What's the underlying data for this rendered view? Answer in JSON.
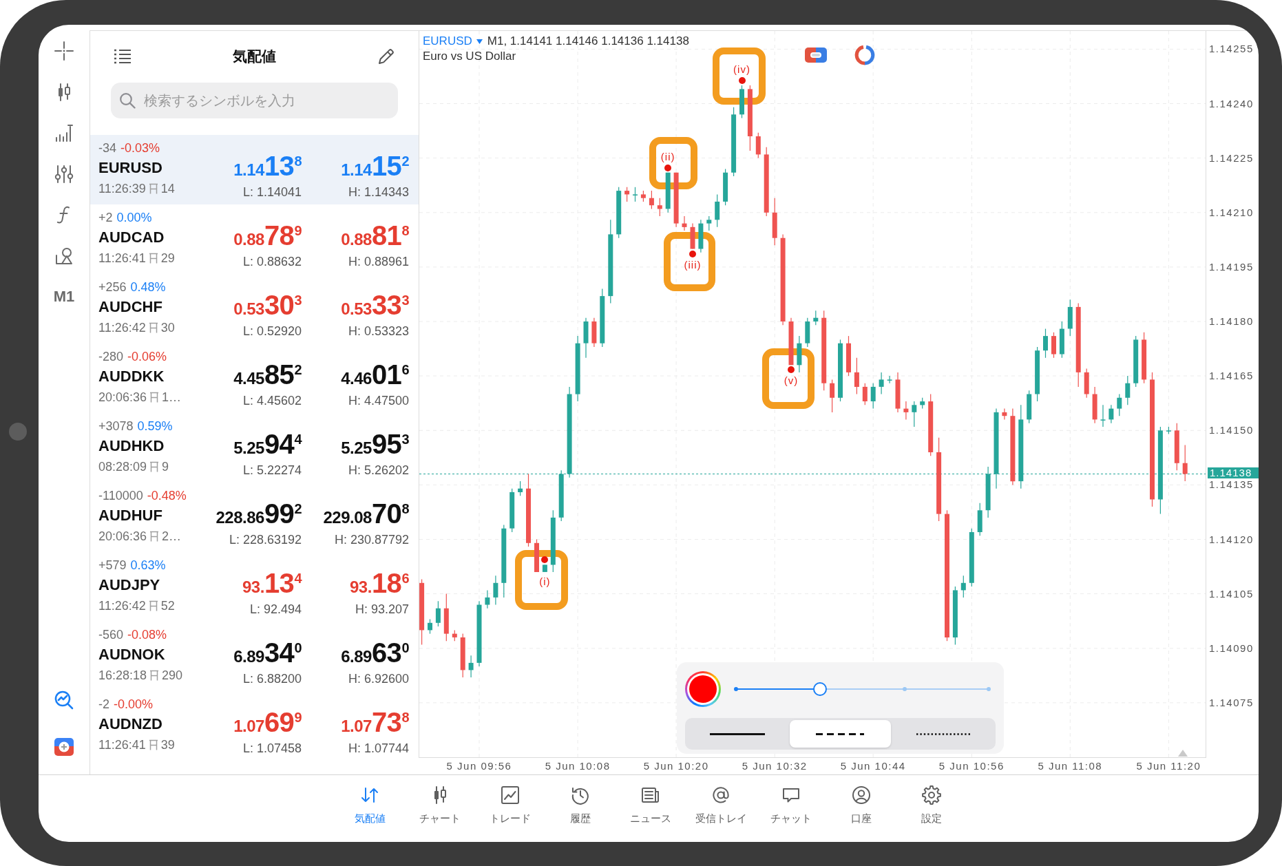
{
  "left_toolbar": {
    "timeframe": "M1"
  },
  "quotes": {
    "title": "気配値",
    "search": {
      "placeholder": "検索するシンボルを入力"
    },
    "rows": [
      {
        "change": "-34",
        "change_pct": {
          "text": "-0.03%",
          "color": "#e53d30"
        },
        "symbol": "EURUSD",
        "time": "11:26:39",
        "spread": "14",
        "bid": {
          "head": "1.14",
          "pips": "13",
          "point": "8",
          "color": "#1a7ff5"
        },
        "ask": {
          "head": "1.14",
          "pips": "15",
          "point": "2",
          "color": "#1a7ff5"
        },
        "low": "L: 1.14041",
        "high": "H: 1.14343",
        "selected": true
      },
      {
        "change": "+2",
        "change_pct": {
          "text": "0.00%",
          "color": "#1a7ff5"
        },
        "symbol": "AUDCAD",
        "time": "11:26:41",
        "spread": "29",
        "bid": {
          "head": "0.88",
          "pips": "78",
          "point": "9",
          "color": "#e53d30"
        },
        "ask": {
          "head": "0.88",
          "pips": "81",
          "point": "8",
          "color": "#e53d30"
        },
        "low": "L: 0.88632",
        "high": "H: 0.88961",
        "selected": false
      },
      {
        "change": "+256",
        "change_pct": {
          "text": "0.48%",
          "color": "#1a7ff5"
        },
        "symbol": "AUDCHF",
        "time": "11:26:42",
        "spread": "30",
        "bid": {
          "head": "0.53",
          "pips": "30",
          "point": "3",
          "color": "#e53d30"
        },
        "ask": {
          "head": "0.53",
          "pips": "33",
          "point": "3",
          "color": "#e53d30"
        },
        "low": "L: 0.52920",
        "high": "H: 0.53323",
        "selected": false
      },
      {
        "change": "-280",
        "change_pct": {
          "text": "-0.06%",
          "color": "#e53d30"
        },
        "symbol": "AUDDKK",
        "time": "20:06:36",
        "spread": "1…",
        "bid": {
          "head": "4.45",
          "pips": "85",
          "point": "2",
          "color": "#111111"
        },
        "ask": {
          "head": "4.46",
          "pips": "01",
          "point": "6",
          "color": "#111111"
        },
        "low": "L: 4.45602",
        "high": "H: 4.47500",
        "selected": false
      },
      {
        "change": "+3078",
        "change_pct": {
          "text": "0.59%",
          "color": "#1a7ff5"
        },
        "symbol": "AUDHKD",
        "time": "08:28:09",
        "spread": "9",
        "bid": {
          "head": "5.25",
          "pips": "94",
          "point": "4",
          "color": "#111111"
        },
        "ask": {
          "head": "5.25",
          "pips": "95",
          "point": "3",
          "color": "#111111"
        },
        "low": "L: 5.22274",
        "high": "H: 5.26202",
        "selected": false
      },
      {
        "change": "-110000",
        "change_pct": {
          "text": "-0.48%",
          "color": "#e53d30"
        },
        "symbol": "AUDHUF",
        "time": "20:06:36",
        "spread": "2…",
        "bid": {
          "head": "228.86",
          "pips": "99",
          "point": "2",
          "color": "#111111"
        },
        "ask": {
          "head": "229.08",
          "pips": "70",
          "point": "8",
          "color": "#111111"
        },
        "low": "L: 228.63192",
        "high": "H: 230.87792",
        "selected": false
      },
      {
        "change": "+579",
        "change_pct": {
          "text": "0.63%",
          "color": "#1a7ff5"
        },
        "symbol": "AUDJPY",
        "time": "11:26:42",
        "spread": "52",
        "bid": {
          "head": "93.",
          "pips": "13",
          "point": "4",
          "color": "#e53d30"
        },
        "ask": {
          "head": "93.",
          "pips": "18",
          "point": "6",
          "color": "#e53d30"
        },
        "low": "L: 92.494",
        "high": "H: 93.207",
        "selected": false
      },
      {
        "change": "-560",
        "change_pct": {
          "text": "-0.08%",
          "color": "#e53d30"
        },
        "symbol": "AUDNOK",
        "time": "16:28:18",
        "spread": "290",
        "bid": {
          "head": "6.89",
          "pips": "34",
          "point": "0",
          "color": "#111111"
        },
        "ask": {
          "head": "6.89",
          "pips": "63",
          "point": "0",
          "color": "#111111"
        },
        "low": "L: 6.88200",
        "high": "H: 6.92600",
        "selected": false
      },
      {
        "change": "-2",
        "change_pct": {
          "text": "-0.00%",
          "color": "#e53d30"
        },
        "symbol": "AUDNZD",
        "time": "11:26:41",
        "spread": "39",
        "bid": {
          "head": "1.07",
          "pips": "69",
          "point": "9",
          "color": "#e53d30"
        },
        "ask": {
          "head": "1.07",
          "pips": "73",
          "point": "8",
          "color": "#e53d30"
        },
        "low": "L: 1.07458",
        "high": "H: 1.07744",
        "selected": false
      }
    ]
  },
  "chart": {
    "symbol": "EURUSD",
    "ohlc_info": "M1, 1.14141 1.14146 1.14136 1.14138",
    "description": "Euro vs US Dollar",
    "wave_labels": [
      "(i)",
      "(ii)",
      "(iii)",
      "(iv)",
      "(v)"
    ],
    "chart_data": {
      "type": "candlestick",
      "grid": true,
      "ylim": [
        1.1406,
        1.1426
      ],
      "yticks": [
        {
          "value": 1.14255,
          "label": "1.14255"
        },
        {
          "value": 1.1424,
          "label": "1.14240"
        },
        {
          "value": 1.14225,
          "label": "1.14225"
        },
        {
          "value": 1.1421,
          "label": "1.14210"
        },
        {
          "value": 1.14195,
          "label": "1.14195"
        },
        {
          "value": 1.1418,
          "label": "1.14180"
        },
        {
          "value": 1.14165,
          "label": "1.14165"
        },
        {
          "value": 1.1415,
          "label": "1.14150"
        },
        {
          "value": 1.14135,
          "label": "1.14135"
        },
        {
          "value": 1.1412,
          "label": "1.14120"
        },
        {
          "value": 1.14105,
          "label": "1.14105"
        },
        {
          "value": 1.1409,
          "label": "1.14090"
        },
        {
          "value": 1.14075,
          "label": "1.14075"
        }
      ],
      "ref_lines": [
        {
          "axis": "y",
          "value": 1.14138,
          "label": "1.14138"
        }
      ],
      "categories": [
        null,
        null,
        null,
        null,
        null,
        null,
        null,
        "5 Jun 09:56",
        null,
        null,
        null,
        null,
        null,
        null,
        null,
        null,
        null,
        null,
        null,
        "5 Jun 10:08",
        null,
        null,
        null,
        null,
        null,
        null,
        null,
        null,
        null,
        null,
        null,
        "5 Jun 10:20",
        null,
        null,
        null,
        null,
        null,
        null,
        null,
        null,
        null,
        null,
        null,
        "5 Jun 10:32",
        null,
        null,
        null,
        null,
        null,
        null,
        null,
        null,
        null,
        null,
        null,
        "5 Jun 10:44",
        null,
        null,
        null,
        null,
        null,
        null,
        null,
        null,
        null,
        null,
        null,
        "5 Jun 10:56",
        null,
        null,
        null,
        null,
        null,
        null,
        null,
        null,
        null,
        null,
        null,
        "5 Jun 11:08",
        null,
        null,
        null,
        null,
        null,
        null,
        null,
        null,
        null,
        null,
        null,
        "5 Jun 11:20",
        null,
        null
      ],
      "ohlc": [
        [
          1.14108,
          1.14109,
          1.14091,
          1.14095
        ],
        [
          1.14095,
          1.14098,
          1.14094,
          1.14097
        ],
        [
          1.14097,
          1.14103,
          1.14096,
          1.14101
        ],
        [
          1.14101,
          1.14105,
          1.14092,
          1.14094
        ],
        [
          1.14094,
          1.14095,
          1.14092,
          1.14093
        ],
        [
          1.14093,
          1.14094,
          1.14082,
          1.14084
        ],
        [
          1.14084,
          1.14088,
          1.14082,
          1.14086
        ],
        [
          1.14086,
          1.14103,
          1.14085,
          1.14102
        ],
        [
          1.14102,
          1.14106,
          1.14101,
          1.14104
        ],
        [
          1.14104,
          1.1411,
          1.14102,
          1.14108
        ],
        [
          1.14108,
          1.14124,
          1.14104,
          1.14123
        ],
        [
          1.14123,
          1.14134,
          1.14122,
          1.14133
        ],
        [
          1.14133,
          1.14136,
          1.14132,
          1.14134
        ],
        [
          1.14134,
          1.14138,
          1.14118,
          1.14119
        ],
        [
          1.14119,
          1.1412,
          1.14111,
          1.14111
        ],
        [
          1.14111,
          1.14113,
          1.14111,
          1.14113
        ],
        [
          1.14113,
          1.14128,
          1.14111,
          1.14126
        ],
        [
          1.14126,
          1.14139,
          1.14125,
          1.14138
        ],
        [
          1.14138,
          1.14162,
          1.14137,
          1.1416
        ],
        [
          1.1416,
          1.14176,
          1.14158,
          1.14174
        ],
        [
          1.14174,
          1.14181,
          1.1417,
          1.1418
        ],
        [
          1.1418,
          1.14181,
          1.14173,
          1.14174
        ],
        [
          1.14174,
          1.14189,
          1.14173,
          1.14187
        ],
        [
          1.14187,
          1.14208,
          1.14185,
          1.14204
        ],
        [
          1.14204,
          1.14217,
          1.14203,
          1.14216
        ],
        [
          1.14216,
          1.14217,
          1.14213,
          1.14215
        ],
        [
          1.14215,
          1.14217,
          1.14213,
          1.14215
        ],
        [
          1.14215,
          1.14216,
          1.14213,
          1.14214
        ],
        [
          1.14214,
          1.14216,
          1.14211,
          1.14212
        ],
        [
          1.14212,
          1.14214,
          1.14209,
          1.14211
        ],
        [
          1.14211,
          1.14221,
          1.1421,
          1.14221
        ],
        [
          1.14221,
          1.14221,
          1.14206,
          1.14207
        ],
        [
          1.14207,
          1.14209,
          1.14205,
          1.14206
        ],
        [
          1.14206,
          1.14207,
          1.142,
          1.142
        ],
        [
          1.142,
          1.14208,
          1.14199,
          1.14207
        ],
        [
          1.14207,
          1.14209,
          1.14205,
          1.14208
        ],
        [
          1.14208,
          1.14215,
          1.14206,
          1.14213
        ],
        [
          1.14213,
          1.14222,
          1.14212,
          1.14221
        ],
        [
          1.14221,
          1.14239,
          1.1422,
          1.14237
        ],
        [
          1.14237,
          1.14245,
          1.14236,
          1.14244
        ],
        [
          1.14244,
          1.14245,
          1.14227,
          1.14231
        ],
        [
          1.14231,
          1.14232,
          1.14225,
          1.14226
        ],
        [
          1.14226,
          1.14228,
          1.14209,
          1.1421
        ],
        [
          1.1421,
          1.14214,
          1.14201,
          1.14203
        ],
        [
          1.14203,
          1.14204,
          1.14179,
          1.1418
        ],
        [
          1.1418,
          1.14181,
          1.14168,
          1.14168
        ],
        [
          1.14168,
          1.14176,
          1.14166,
          1.14174
        ],
        [
          1.14174,
          1.14181,
          1.14173,
          1.1418
        ],
        [
          1.1418,
          1.14183,
          1.14179,
          1.14181
        ],
        [
          1.14181,
          1.14183,
          1.14161,
          1.14163
        ],
        [
          1.14163,
          1.14164,
          1.14155,
          1.14159
        ],
        [
          1.14159,
          1.14175,
          1.14158,
          1.14174
        ],
        [
          1.14174,
          1.14176,
          1.14165,
          1.14166
        ],
        [
          1.14166,
          1.1417,
          1.1416,
          1.14162
        ],
        [
          1.14162,
          1.14163,
          1.14157,
          1.14158
        ],
        [
          1.14158,
          1.14163,
          1.14156,
          1.14162
        ],
        [
          1.14162,
          1.14166,
          1.1416,
          1.14164
        ],
        [
          1.14164,
          1.14165,
          1.14163,
          1.14164
        ],
        [
          1.14164,
          1.14166,
          1.14155,
          1.14156
        ],
        [
          1.14156,
          1.14158,
          1.14153,
          1.14155
        ],
        [
          1.14155,
          1.14158,
          1.14151,
          1.14157
        ],
        [
          1.14157,
          1.14159,
          1.14156,
          1.14158
        ],
        [
          1.14158,
          1.1416,
          1.14143,
          1.14144
        ],
        [
          1.14144,
          1.14148,
          1.14125,
          1.14127
        ],
        [
          1.14127,
          1.14128,
          1.14092,
          1.14093
        ],
        [
          1.14093,
          1.14107,
          1.14091,
          1.14106
        ],
        [
          1.14106,
          1.1411,
          1.14104,
          1.14108
        ],
        [
          1.14108,
          1.14123,
          1.14107,
          1.14122
        ],
        [
          1.14122,
          1.1413,
          1.14121,
          1.14128
        ],
        [
          1.14128,
          1.1414,
          1.14126,
          1.14138
        ],
        [
          1.14138,
          1.14156,
          1.14134,
          1.14155
        ],
        [
          1.14155,
          1.14156,
          1.14153,
          1.14154
        ],
        [
          1.14154,
          1.14156,
          1.14135,
          1.14136
        ],
        [
          1.14136,
          1.14157,
          1.14134,
          1.14153
        ],
        [
          1.14153,
          1.14161,
          1.14152,
          1.1416
        ],
        [
          1.1416,
          1.14173,
          1.14158,
          1.14172
        ],
        [
          1.14172,
          1.14178,
          1.1417,
          1.14176
        ],
        [
          1.14176,
          1.14177,
          1.1417,
          1.14171
        ],
        [
          1.14171,
          1.1418,
          1.1417,
          1.14178
        ],
        [
          1.14178,
          1.14186,
          1.14176,
          1.14184
        ],
        [
          1.14184,
          1.14185,
          1.14162,
          1.14166
        ],
        [
          1.14166,
          1.14167,
          1.14159,
          1.1416
        ],
        [
          1.1416,
          1.14162,
          1.14152,
          1.14153
        ],
        [
          1.14153,
          1.14157,
          1.14151,
          1.14153
        ],
        [
          1.14153,
          1.14157,
          1.14152,
          1.14156
        ],
        [
          1.14156,
          1.1416,
          1.14154,
          1.14159
        ],
        [
          1.14159,
          1.14165,
          1.14157,
          1.14163
        ],
        [
          1.14163,
          1.14176,
          1.14162,
          1.14175
        ],
        [
          1.14175,
          1.14177,
          1.14163,
          1.14164
        ],
        [
          1.14164,
          1.14166,
          1.14129,
          1.14131
        ],
        [
          1.14131,
          1.14151,
          1.14127,
          1.1415
        ],
        [
          1.1415,
          1.14151,
          1.14149,
          1.1415
        ],
        [
          1.1415,
          1.14152,
          1.14139,
          1.14141
        ],
        [
          1.14141,
          1.14146,
          1.14136,
          1.14138
        ]
      ]
    }
  },
  "drawing_panel": {
    "color": "#ff0000",
    "line_width": {
      "level": 0.333
    },
    "line_styles": [
      {
        "kind": "solid",
        "selected": false
      },
      {
        "kind": "dashed",
        "selected": true
      },
      {
        "kind": "dotted",
        "selected": false
      }
    ]
  },
  "tab_bar": {
    "tabs": [
      {
        "label": "気配値",
        "selected": true
      },
      {
        "label": "チャート",
        "selected": false
      },
      {
        "label": "トレード",
        "selected": false
      },
      {
        "label": "履歴",
        "selected": false
      },
      {
        "label": "ニュース",
        "selected": false
      },
      {
        "label": "受信トレイ",
        "selected": false
      },
      {
        "label": "チャット",
        "selected": false
      },
      {
        "label": "口座",
        "selected": false
      },
      {
        "label": "設定",
        "selected": false
      }
    ]
  }
}
